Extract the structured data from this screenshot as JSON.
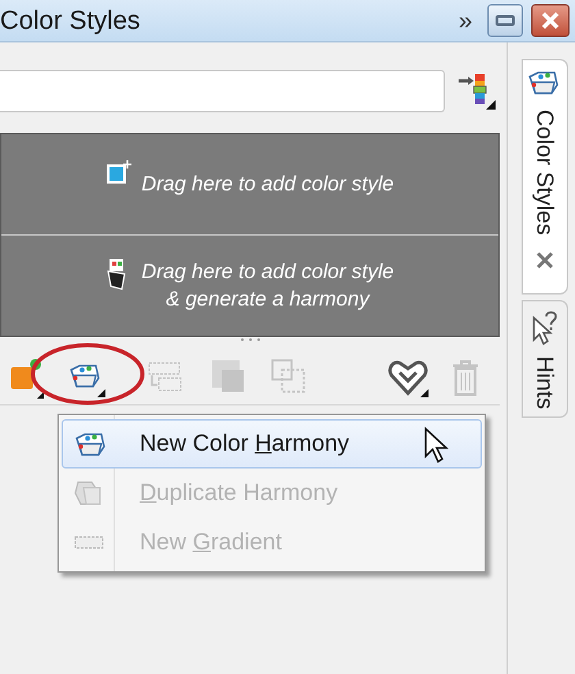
{
  "window": {
    "title": "Color Styles",
    "overflow_glyph": "»"
  },
  "drop_zones": [
    {
      "lines": [
        "Drag here to add color style"
      ],
      "kind": "style"
    },
    {
      "lines": [
        "Drag here to add color style",
        "& generate a harmony"
      ],
      "kind": "harmony"
    }
  ],
  "toolbar": [
    {
      "kind": "new-style",
      "disabled": false
    },
    {
      "kind": "new-harmony",
      "disabled": false,
      "highlighted": true
    },
    {
      "kind": "grid-a",
      "disabled": true
    },
    {
      "kind": "grid-b",
      "disabled": true
    },
    {
      "kind": "grid-c",
      "disabled": true
    },
    {
      "kind": "heart",
      "disabled": false
    },
    {
      "kind": "trash",
      "disabled": true
    }
  ],
  "menu": [
    {
      "before": "New Color ",
      "key": "H",
      "after": "armony",
      "selected": true,
      "disabled": false
    },
    {
      "key": "D",
      "after": "uplicate Harmony",
      "selected": false,
      "disabled": true
    },
    {
      "before": "New ",
      "key": "G",
      "after": "radient",
      "selected": false,
      "disabled": true
    }
  ],
  "side_tabs": [
    {
      "label": "Color Styles",
      "selected": true,
      "closable": true
    },
    {
      "label": "Hints",
      "selected": false,
      "closable": false
    }
  ]
}
